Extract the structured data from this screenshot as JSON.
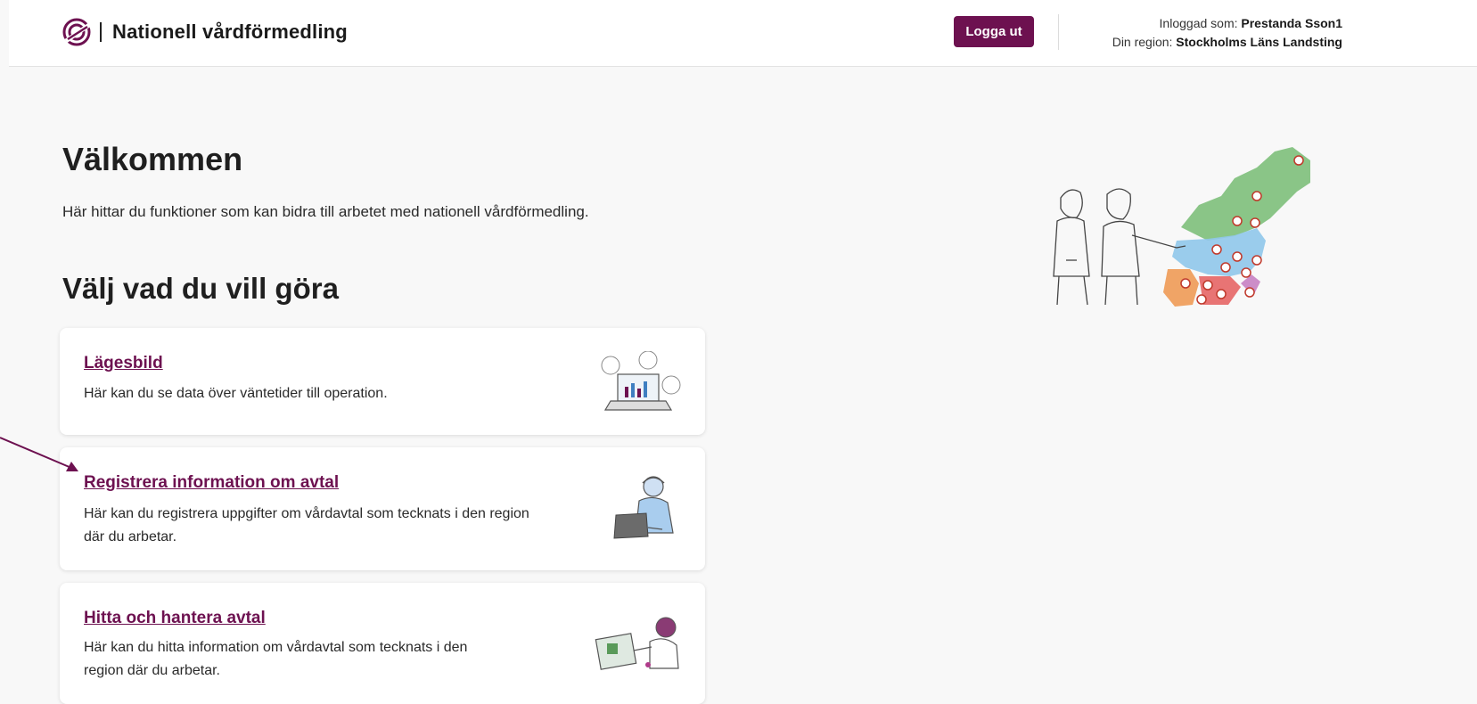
{
  "header": {
    "brand_name": "Nationell vårdförmedling",
    "logout_label": "Logga ut",
    "logged_in_prefix": "Inloggad som:",
    "logged_in_user": "Prestanda Sson1",
    "region_prefix": "Din region:",
    "region_name": "Stockholms Läns Landsting"
  },
  "main": {
    "welcome_title": "Välkommen",
    "welcome_text": "Här hittar du funktioner som kan bidra till arbetet med nationell vårdförmedling.",
    "choose_title": "Välj vad du vill göra",
    "cards": [
      {
        "title": "Lägesbild",
        "description": "Här kan du se data över väntetider till operation.",
        "icon": "laptop-chart-icon"
      },
      {
        "title": "Registrera information om avtal",
        "description": "Här kan du registrera uppgifter om vårdavtal som tecknats i den region där du arbetar.",
        "icon": "person-laptop-icon"
      },
      {
        "title": "Hitta och hantera avtal",
        "description": "Här kan du hitta information om vårdavtal som tecknats i den region där du arbetar.",
        "icon": "person-document-icon"
      }
    ]
  },
  "colors": {
    "brand": "#6d1150",
    "background": "#f8f8f8",
    "card": "#ffffff"
  }
}
